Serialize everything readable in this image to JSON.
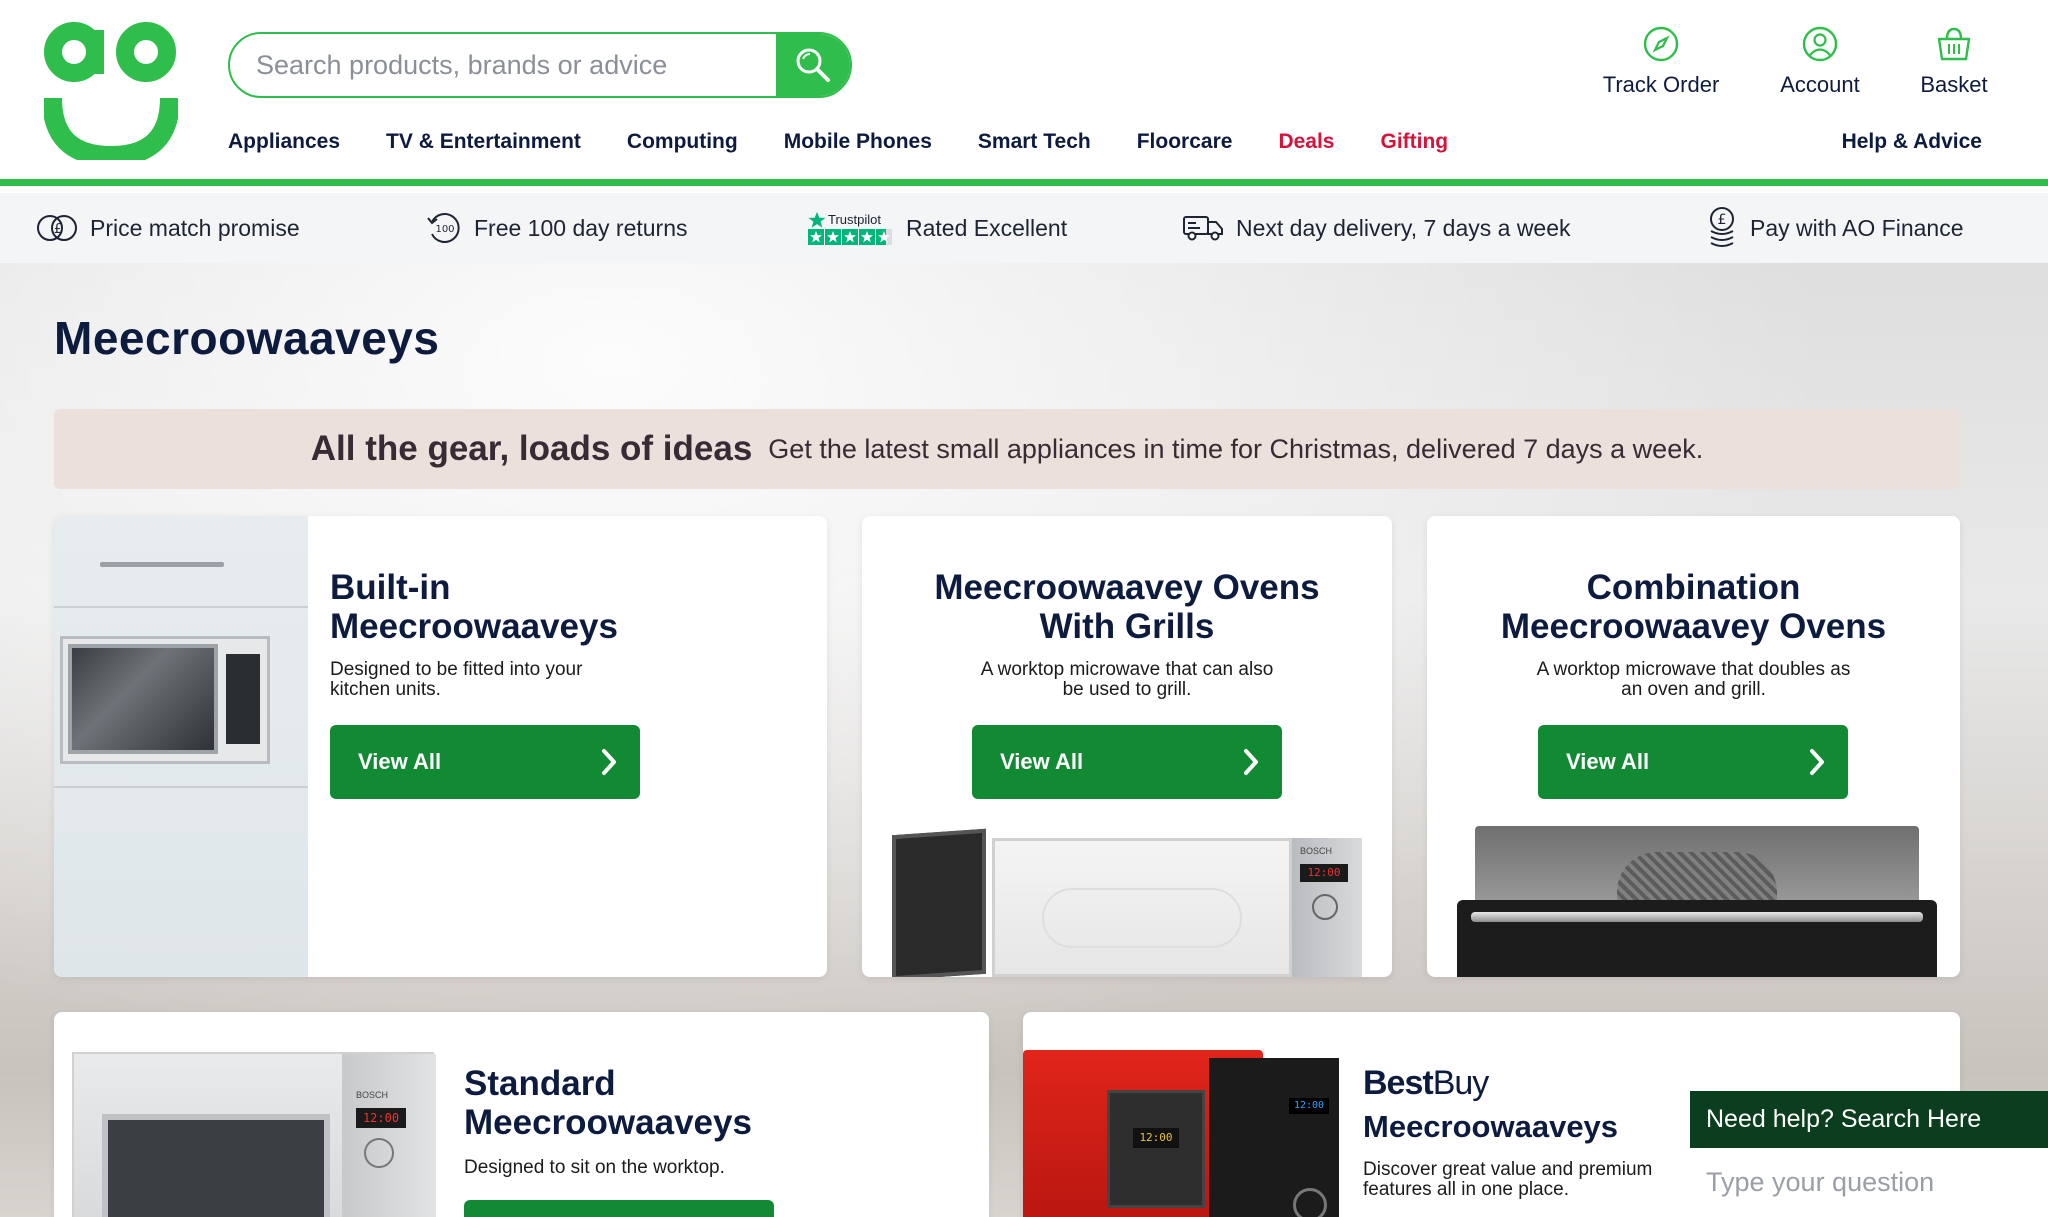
{
  "header": {
    "search_placeholder": "Search products, brands or advice",
    "utility": {
      "track_order": "Track Order",
      "account": "Account",
      "basket": "Basket"
    },
    "nav": [
      {
        "label": "Appliances",
        "highlight": false
      },
      {
        "label": "TV & Entertainment",
        "highlight": false
      },
      {
        "label": "Computing",
        "highlight": false
      },
      {
        "label": "Mobile Phones",
        "highlight": false
      },
      {
        "label": "Smart Tech",
        "highlight": false
      },
      {
        "label": "Floorcare",
        "highlight": false
      },
      {
        "label": "Deals",
        "highlight": true
      },
      {
        "label": "Gifting",
        "highlight": true
      }
    ],
    "help": "Help & Advice"
  },
  "usp": {
    "price_match": "Price match promise",
    "returns": "Free 100 day returns",
    "returns_badge": "100",
    "trustpilot_brand": "Trustpilot",
    "rated": "Rated Excellent",
    "delivery": "Next day delivery, 7 days a week",
    "finance": "Pay with AO Finance"
  },
  "page": {
    "title": "Meecroowaaveys",
    "promo_headline": "All the gear, loads of ideas",
    "promo_text": "Get the latest small appliances in time for Christmas, delivered 7 days a week."
  },
  "cards": {
    "builtin": {
      "title_line1": "Built-in",
      "title_line2": "Meecroowaaveys",
      "desc_line1": "Designed to be fitted into your",
      "desc_line2": "kitchen units.",
      "button": "View All"
    },
    "grills": {
      "title_line1": "Meecroowaavey Ovens",
      "title_line2": "With Grills",
      "desc_line1": "A worktop microwave that can also",
      "desc_line2": "be used to grill.",
      "button": "View All"
    },
    "combination": {
      "title_line1": "Combination",
      "title_line2": "Meecroowaavey Ovens",
      "desc_line1": "A worktop microwave that doubles as",
      "desc_line2": "an oven and grill.",
      "button": "View All"
    },
    "standard": {
      "title_line1": "Standard",
      "title_line2": "Meecroowaaveys",
      "desc": "Designed to sit on the worktop."
    },
    "bestbuy": {
      "brand_bold": "Best",
      "brand_light": "Buy",
      "title": "Meecroowaaveys",
      "desc_line1": "Discover great value and premium",
      "desc_line2": "features all in one place."
    }
  },
  "appliance_displays": {
    "grill_display": "12:00",
    "standard_display": "12:00",
    "red_display": "12:00",
    "black_display": "12:00",
    "bosch_label": "BOSCH"
  },
  "chat": {
    "title": "Need help? Search Here",
    "placeholder": "Type your question"
  },
  "colors": {
    "brand_green": "#2fbd4b",
    "button_green": "#128a34",
    "navy": "#0d1b3e",
    "deal_red": "#d4143a",
    "chat_green": "#0b3d1f",
    "promo_bg": "#ece0dc"
  }
}
